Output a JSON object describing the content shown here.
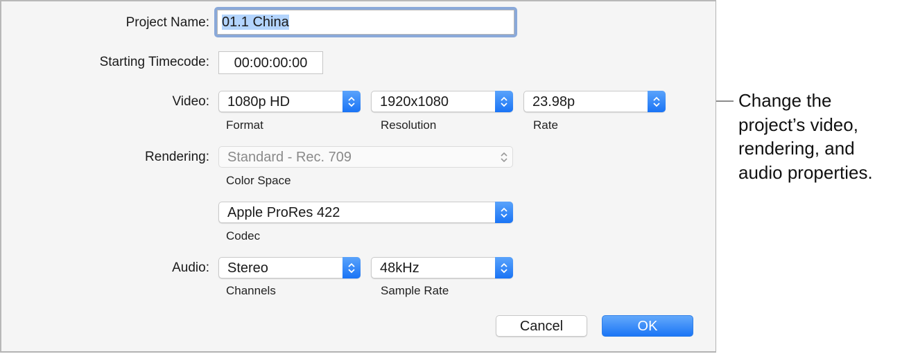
{
  "dialog": {
    "project_name": {
      "label": "Project Name:",
      "value": "01.1 China"
    },
    "starting_timecode": {
      "label": "Starting Timecode:",
      "value": "00:00:00:00"
    },
    "video": {
      "label": "Video:",
      "format": {
        "value": "1080p HD",
        "caption": "Format"
      },
      "resolution": {
        "value": "1920x1080",
        "caption": "Resolution"
      },
      "rate": {
        "value": "23.98p",
        "caption": "Rate"
      }
    },
    "rendering": {
      "label": "Rendering:",
      "color_space": {
        "value": "Standard - Rec. 709",
        "caption": "Color Space",
        "enabled": false
      },
      "codec": {
        "value": "Apple ProRes 422",
        "caption": "Codec"
      }
    },
    "audio": {
      "label": "Audio:",
      "channels": {
        "value": "Stereo",
        "caption": "Channels"
      },
      "sample_rate": {
        "value": "48kHz",
        "caption": "Sample Rate"
      }
    },
    "buttons": {
      "cancel": "Cancel",
      "ok": "OK"
    }
  },
  "callout": {
    "lines": [
      "Change the",
      "project’s video,",
      "rendering, and",
      "audio properties."
    ]
  },
  "colors": {
    "accent": "#1b75f5",
    "focus_ring": "#8aa9d9",
    "selection": "#b3d4fd"
  }
}
